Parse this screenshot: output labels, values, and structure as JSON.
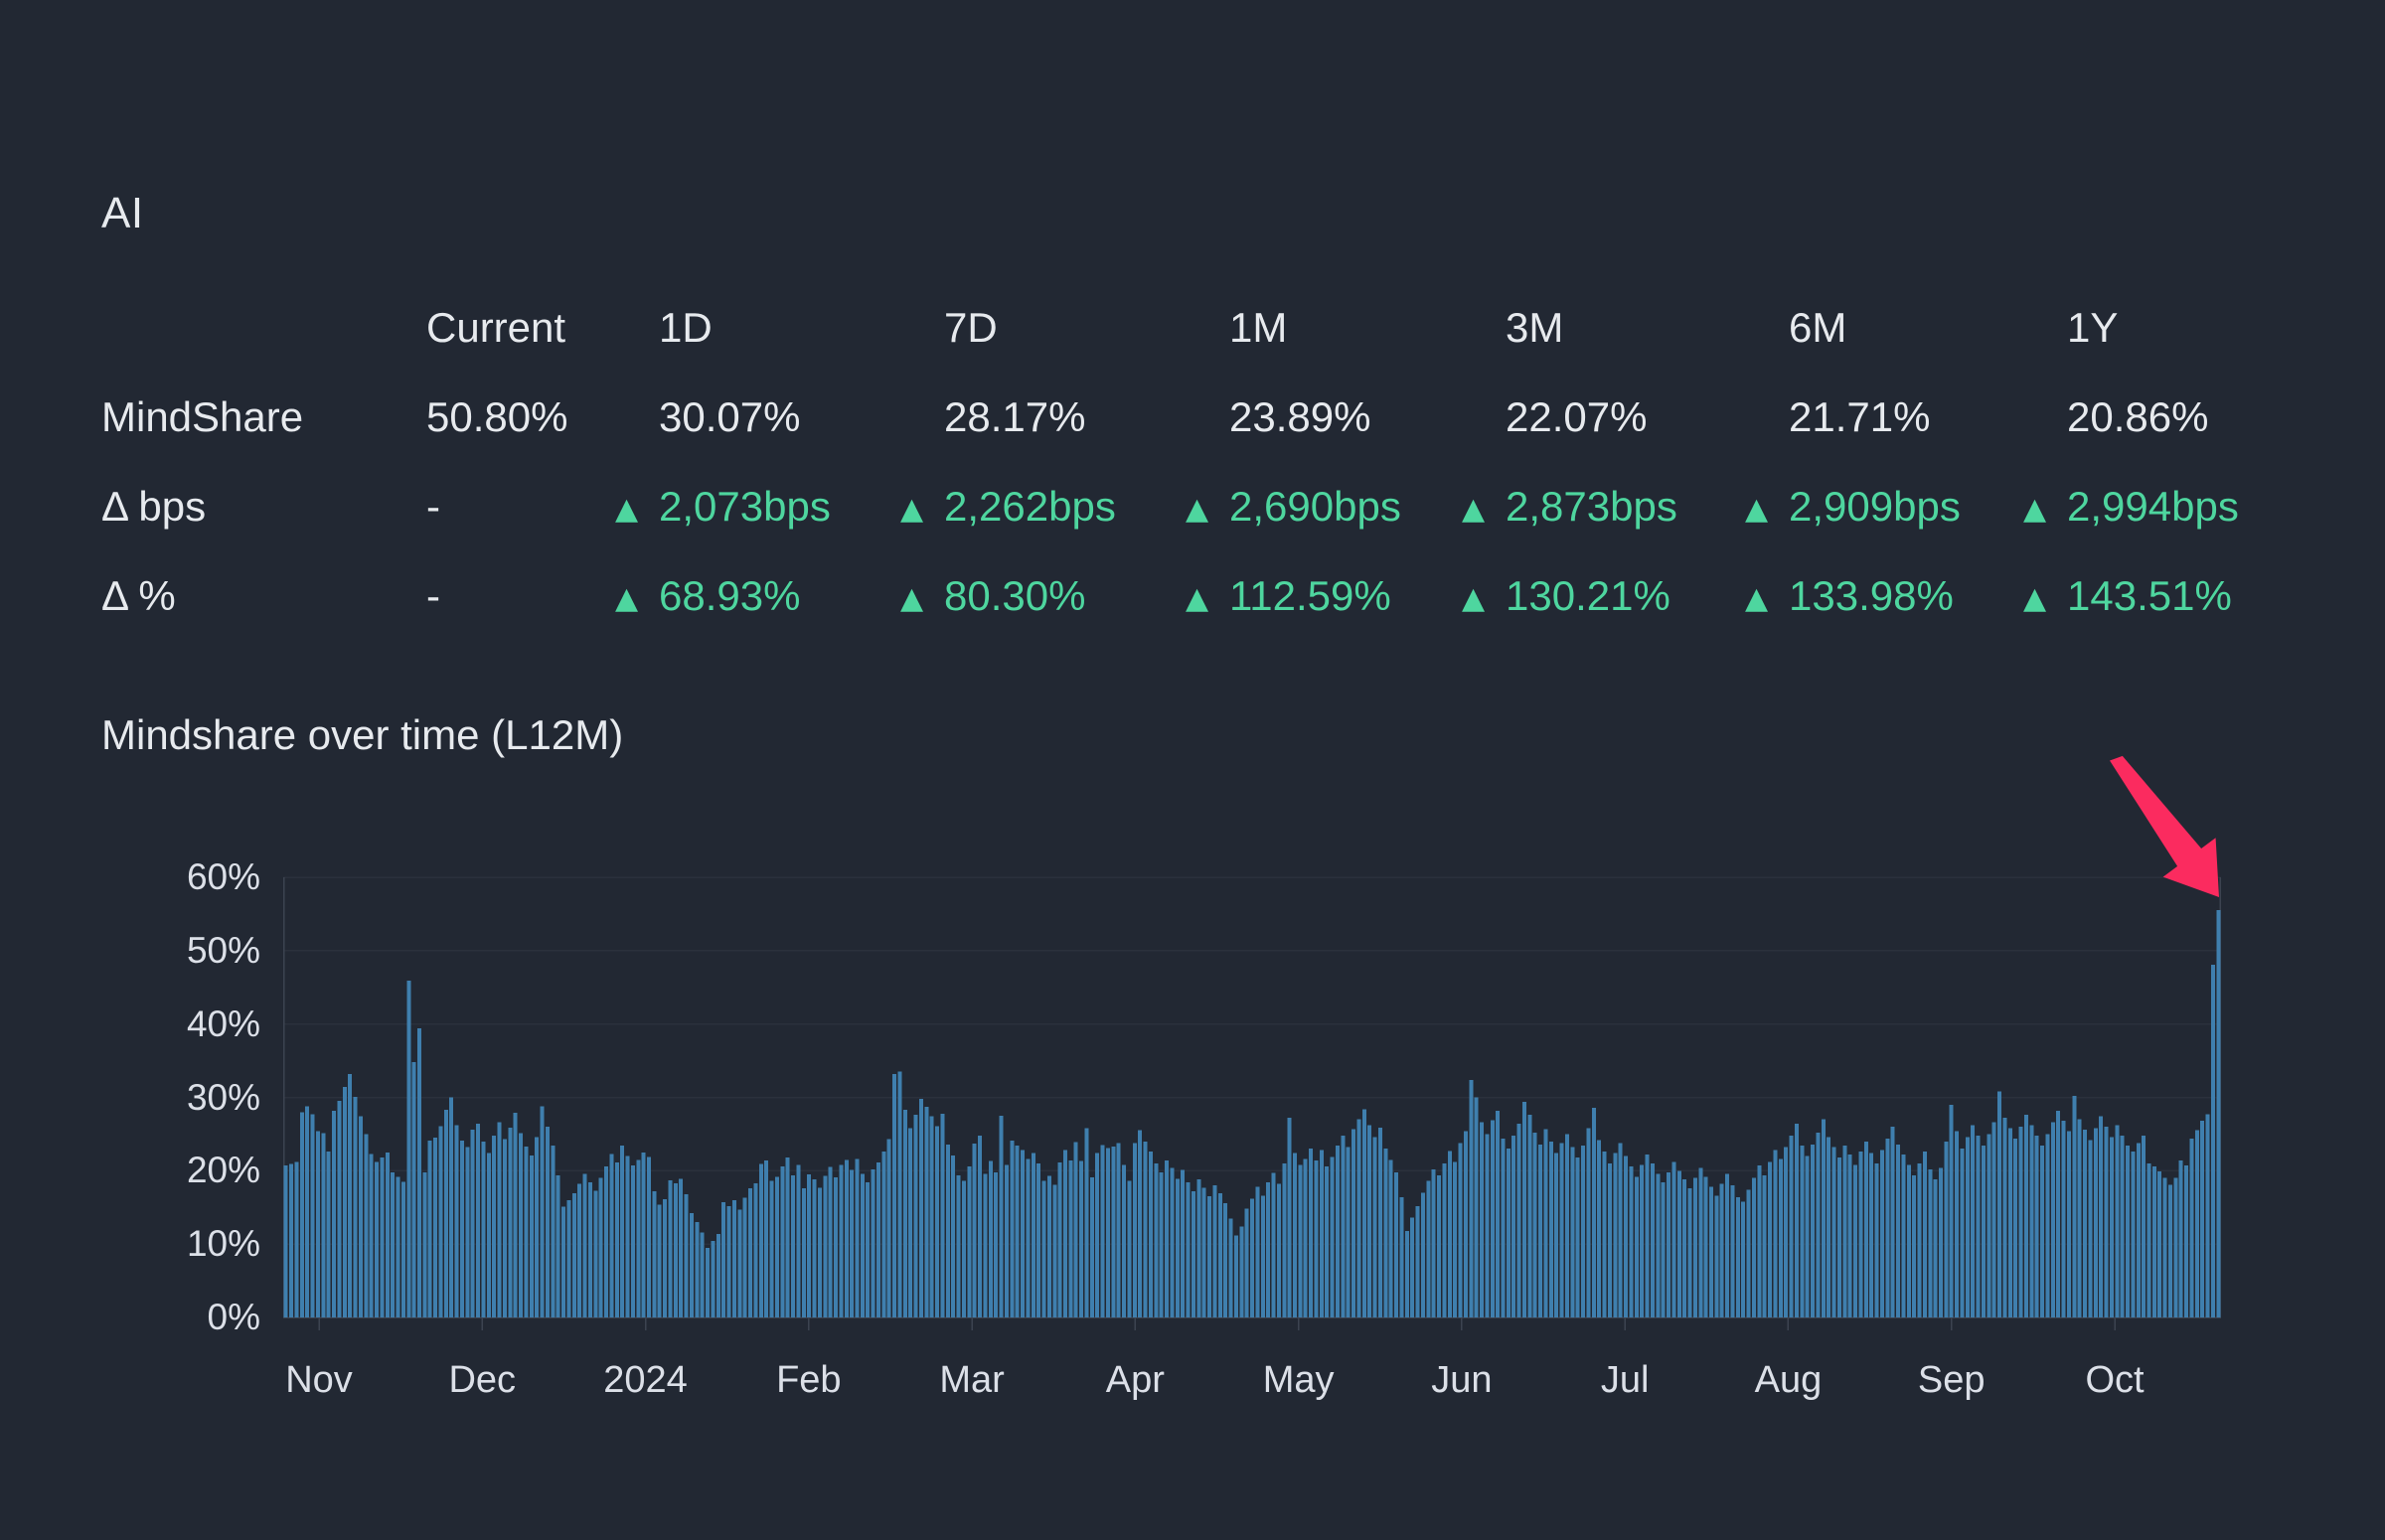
{
  "page": {
    "title": "AI",
    "background": "#222833"
  },
  "stats_table": {
    "up_marker": "▲",
    "positive_color": "#4ed69f",
    "columns": [
      "Current",
      "1D",
      "7D",
      "1M",
      "3M",
      "6M",
      "1Y"
    ],
    "rows": [
      {
        "label": "MindShare",
        "type": "plain",
        "values": [
          "50.80%",
          "30.07%",
          "28.17%",
          "23.89%",
          "22.07%",
          "21.71%",
          "20.86%"
        ]
      },
      {
        "label": "Δ bps",
        "type": "delta",
        "values": [
          "-",
          "2,073bps",
          "2,262bps",
          "2,690bps",
          "2,873bps",
          "2,909bps",
          "2,994bps"
        ]
      },
      {
        "label": "Δ %",
        "type": "delta",
        "values": [
          "-",
          "68.93%",
          "80.30%",
          "112.59%",
          "130.21%",
          "133.98%",
          "143.51%"
        ]
      }
    ]
  },
  "chart": {
    "heading": "Mindshare over time (L12M)"
  },
  "chart_data": {
    "type": "bar",
    "title": "Mindshare over time (L12M)",
    "unit": "%",
    "ylim": [
      0,
      60
    ],
    "grid": true,
    "bar_color": "#3f7fae",
    "x_tick_labels": [
      "Nov",
      "Dec",
      "2024",
      "Feb",
      "Mar",
      "Apr",
      "May",
      "Jun",
      "Jul",
      "Aug",
      "Sep",
      "Oct"
    ],
    "y_tick_labels": [
      "0%",
      "10%",
      "20%",
      "30%",
      "40%",
      "50%",
      "60%"
    ],
    "annotation_arrow": {
      "points_at": "last-bar",
      "color": "#fb2b5f"
    },
    "values": [
      20.7,
      20.9,
      21.2,
      28.0,
      28.8,
      27.7,
      25.4,
      25.1,
      22.6,
      28.2,
      29.5,
      31.4,
      33.2,
      30.1,
      27.4,
      25.0,
      22.3,
      21.2,
      21.8,
      22.5,
      19.8,
      19.2,
      18.5,
      45.9,
      34.8,
      39.4,
      19.8,
      24.1,
      24.5,
      26.1,
      28.3,
      30.0,
      26.2,
      24.1,
      23.2,
      25.6,
      26.4,
      24.0,
      22.4,
      24.8,
      26.6,
      24.3,
      25.9,
      27.9,
      25.1,
      23.3,
      22.1,
      24.6,
      28.8,
      26.0,
      23.4,
      19.4,
      15.1,
      16.0,
      16.9,
      18.2,
      19.6,
      18.4,
      17.3,
      19.0,
      20.6,
      22.3,
      21.1,
      23.4,
      22.0,
      20.7,
      21.5,
      22.5,
      21.9,
      17.2,
      15.4,
      16.1,
      18.7,
      18.3,
      18.9,
      16.8,
      14.2,
      13.0,
      11.6,
      9.5,
      10.4,
      11.4,
      15.7,
      15.2,
      16.0,
      14.7,
      16.3,
      17.6,
      18.3,
      20.9,
      21.4,
      18.6,
      19.2,
      20.6,
      21.8,
      19.4,
      20.8,
      17.6,
      19.5,
      18.8,
      17.7,
      19.3,
      20.5,
      19.1,
      20.8,
      21.5,
      20.1,
      21.6,
      19.6,
      18.4,
      20.2,
      21.1,
      22.6,
      24.3,
      33.2,
      33.5,
      28.3,
      25.8,
      27.6,
      29.8,
      28.7,
      27.4,
      26.1,
      27.8,
      23.6,
      22.1,
      19.4,
      18.6,
      20.6,
      23.7,
      24.8,
      19.6,
      21.3,
      19.8,
      27.5,
      20.8,
      24.1,
      23.4,
      22.8,
      21.6,
      22.4,
      21.0,
      18.6,
      19.3,
      18.1,
      21.1,
      22.8,
      21.4,
      23.9,
      21.3,
      25.8,
      19.1,
      22.4,
      23.5,
      23.1,
      23.3,
      23.8,
      20.8,
      18.6,
      23.8,
      25.5,
      24.0,
      22.6,
      21.0,
      19.8,
      21.4,
      20.4,
      18.9,
      20.1,
      18.4,
      17.2,
      18.8,
      17.7,
      16.5,
      18.0,
      16.9,
      15.6,
      13.5,
      11.2,
      12.4,
      14.8,
      16.2,
      17.8,
      16.6,
      18.4,
      19.7,
      18.2,
      21.0,
      27.2,
      22.4,
      20.8,
      21.6,
      23.0,
      21.4,
      22.8,
      20.6,
      21.9,
      23.4,
      24.8,
      23.2,
      25.7,
      27.0,
      28.4,
      26.2,
      24.6,
      25.9,
      23.0,
      21.5,
      19.8,
      16.4,
      11.8,
      13.6,
      15.2,
      17.0,
      18.6,
      20.2,
      19.4,
      21.0,
      22.7,
      21.2,
      23.8,
      25.4,
      32.4,
      30.0,
      26.6,
      25.0,
      26.9,
      28.2,
      24.4,
      23.0,
      24.8,
      26.4,
      29.4,
      27.6,
      25.2,
      23.6,
      25.7,
      24.0,
      22.4,
      23.8,
      25.0,
      23.2,
      21.8,
      23.4,
      25.8,
      28.6,
      24.2,
      22.6,
      21.0,
      22.4,
      23.8,
      22.0,
      20.6,
      19.2,
      20.8,
      22.2,
      21.0,
      19.6,
      18.4,
      19.8,
      21.2,
      20.0,
      18.8,
      17.6,
      19.0,
      20.4,
      19.2,
      17.8,
      16.6,
      18.2,
      19.6,
      18.0,
      16.4,
      15.8,
      17.4,
      19.0,
      20.7,
      19.4,
      21.2,
      22.8,
      21.6,
      23.2,
      24.8,
      26.4,
      23.4,
      22.0,
      23.6,
      25.2,
      27.0,
      24.6,
      23.2,
      21.8,
      23.4,
      22.2,
      20.8,
      22.6,
      24.0,
      22.4,
      21.0,
      22.8,
      24.4,
      26.0,
      23.6,
      22.2,
      20.8,
      19.4,
      21.0,
      22.6,
      20.2,
      18.8,
      20.4,
      24.0,
      29.0,
      25.4,
      23.0,
      24.6,
      26.2,
      24.8,
      23.4,
      25.0,
      26.6,
      30.8,
      27.2,
      25.8,
      24.4,
      26.0,
      27.6,
      26.2,
      24.8,
      23.4,
      25.0,
      26.6,
      28.2,
      26.8,
      25.4,
      30.2,
      27.0,
      25.6,
      24.2,
      25.8,
      27.4,
      26.0,
      24.6,
      26.2,
      24.8,
      23.4,
      22.6,
      23.8,
      24.8,
      21.0,
      20.6,
      19.9,
      19.0,
      18.1,
      19.0,
      21.4,
      20.7,
      24.4,
      25.5,
      26.8,
      27.7,
      48.1,
      55.5
    ]
  }
}
